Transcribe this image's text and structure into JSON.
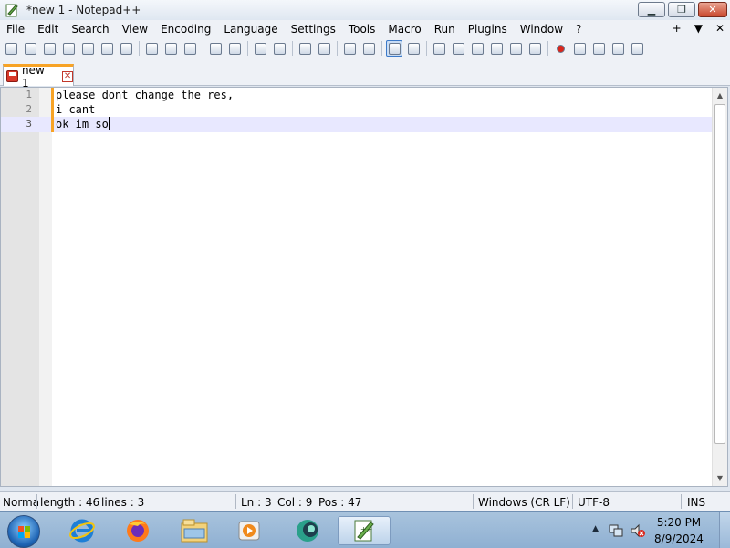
{
  "window": {
    "title": "*new 1 - Notepad++",
    "controls": {
      "minimize": "▁",
      "maximize": "❐",
      "close": "✕"
    }
  },
  "menu": {
    "items": [
      "File",
      "Edit",
      "Search",
      "View",
      "Encoding",
      "Language",
      "Settings",
      "Tools",
      "Macro",
      "Run",
      "Plugins",
      "Window",
      "?"
    ],
    "right": {
      "plus": "+",
      "dropdown": "▼",
      "close": "✕"
    }
  },
  "toolbar": {
    "icons": [
      "new-file-icon",
      "open-file-icon",
      "save-icon",
      "save-all-icon",
      "close-icon",
      "close-all-icon",
      "print-icon",
      "cut-icon",
      "copy-icon",
      "paste-icon",
      "undo-icon",
      "redo-icon",
      "find-icon",
      "replace-icon",
      "zoom-in-icon",
      "zoom-out-icon",
      "sync-vertical-icon",
      "sync-horizontal-icon",
      "word-wrap-icon",
      "show-all-characters-icon",
      "indent-guide-icon",
      "user-defined-language-icon",
      "document-map-icon",
      "function-list-icon",
      "folder-as-workspace-icon",
      "monitoring-icon",
      "record-macro-icon",
      "stop-macro-icon",
      "play-macro-icon",
      "run-macro-multiple-icon",
      "save-macro-icon"
    ]
  },
  "tabs": [
    {
      "label": "new 1",
      "close": "✕"
    }
  ],
  "editor": {
    "lines": [
      {
        "number": "1",
        "text": "please dont change the res,"
      },
      {
        "number": "2",
        "text": "i cant"
      },
      {
        "number": "3",
        "text": "ok im so"
      }
    ],
    "current_line": 3
  },
  "status": {
    "language": "Norma",
    "length": "length : 46",
    "lines": "lines : 3",
    "ln": "Ln : 3",
    "col": "Col : 9",
    "pos": "Pos : 47",
    "eol": "Windows (CR LF)",
    "encoding": "UTF-8",
    "mode": "INS"
  },
  "taskbar": {
    "apps": [
      "internet-explorer-icon",
      "firefox-icon",
      "file-explorer-icon",
      "media-player-icon",
      "app-icon",
      "notepad-plus-plus-icon"
    ],
    "time": "5:20 PM",
    "date": "8/9/2024"
  }
}
